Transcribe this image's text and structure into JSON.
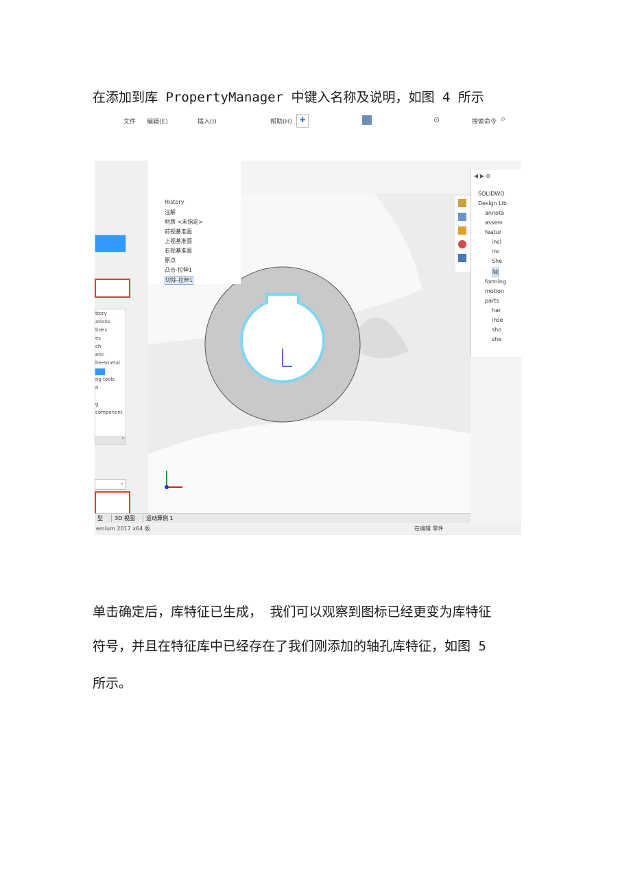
{
  "document": {
    "caption_line": "在添加到库 PropertyManager 中键入名称及说明，如图 4 所示",
    "para2_line1": "单击确定后，库特征已生成，  我们可以观察到图标已经更变为库特征",
    "para2_line2": "符号，并且在特征库中已经存在了我们刚添加的轴孔库特征，如图 5",
    "para2_line3": "所示。"
  },
  "toolbar": {
    "file": "文件",
    "edit": "编辑(E)",
    "insert": "插入(I)",
    "help": "帮助(H)",
    "search": "搜索命令"
  },
  "feature_tree": {
    "items": [
      "History",
      "注解",
      "材质 <未指定>",
      "前视基准面",
      "上视基准面",
      "右视基准面",
      "原点",
      "凸台-拉伸1",
      "切除-拉伸1"
    ]
  },
  "left_list": {
    "items": [
      "ttery",
      "ations",
      "tides",
      "es",
      "ch",
      "etic",
      "heetmetal",
      "",
      "ng tools",
      "n",
      "",
      "g",
      "component"
    ]
  },
  "design_library": {
    "items": [
      "SOLIDWO",
      "Design Lib",
      "annota",
      "assem",
      "featur",
      "incl",
      "inc",
      "She",
      "轴",
      "forming",
      "motion",
      "parts",
      "har",
      "inse",
      "sho",
      "she"
    ]
  },
  "bottom_tabs": [
    "型",
    "3D 视图",
    "运动算例 1"
  ],
  "status": {
    "left": "emium 2017 x64 版",
    "right": "在编辑 零件"
  },
  "colors": {
    "ring": "#c8c8c8",
    "keyway_outline": "#7fd6f0",
    "selected": "#3399ff",
    "red_box": "#e53935"
  }
}
